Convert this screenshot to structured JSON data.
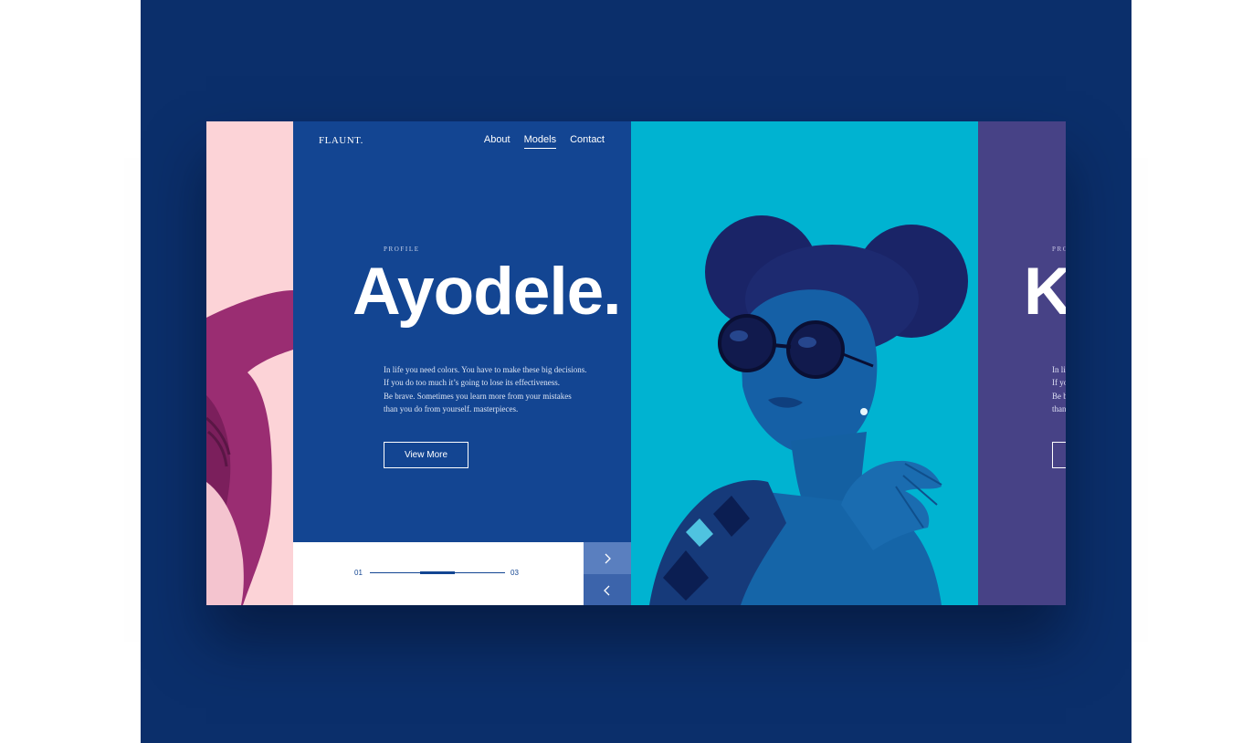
{
  "brand": "FLAUNT.",
  "nav": {
    "items": [
      {
        "label": "About",
        "active": false
      },
      {
        "label": "Models",
        "active": true
      },
      {
        "label": "Contact",
        "active": false
      }
    ]
  },
  "profile": {
    "eyebrow": "PROFILE",
    "name": "Ayodele.",
    "description": [
      "In life you need colors. You have to make these big decisions.",
      "If you do too much it’s going to lose its effectiveness.",
      "Be brave. Sometimes you learn more from your mistakes",
      "than you do from yourself. masterpieces."
    ],
    "cta_label": "View More"
  },
  "pager": {
    "start_label": "01",
    "end_label": "03",
    "progress": 0.5
  },
  "next_profile": {
    "eyebrow_partial": "PRO",
    "name_partial": "K",
    "description_partial": [
      "In li",
      "If yo",
      "Be b",
      "than"
    ]
  },
  "icons": {
    "next": "chevron-right-icon",
    "prev": "chevron-left-icon"
  },
  "colors": {
    "backdrop": "#0b2f6b",
    "main_panel": "#134592",
    "photo_panel": "#00b3d1",
    "prev_panel": "#fcd3d7",
    "next_panel": "#474286",
    "arrow_next": "#5a7fbf",
    "arrow_prev": "#3c64ab"
  }
}
